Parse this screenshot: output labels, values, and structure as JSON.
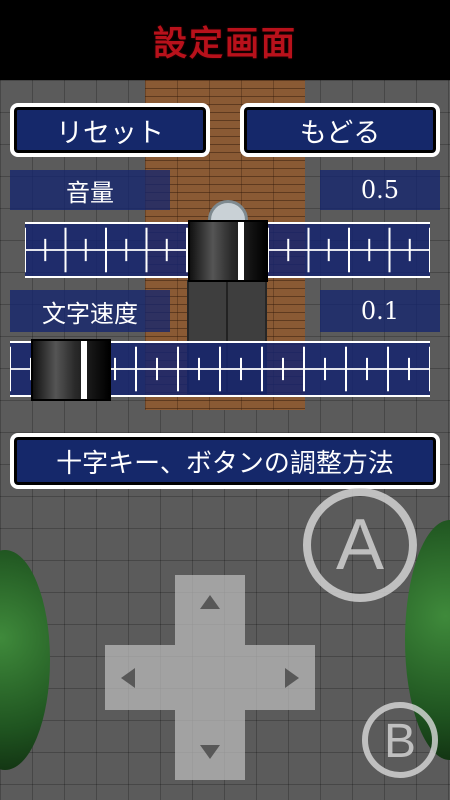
{
  "header": {
    "title": "設定画面"
  },
  "buttons": {
    "reset": "リセット",
    "back": "もどる",
    "adjust": "十字キー、ボタンの調整方法"
  },
  "volume": {
    "label": "音量",
    "value": "0.5",
    "level": 0.5
  },
  "text_speed": {
    "label": "文字速度",
    "value": "0.1",
    "level": 0.1
  },
  "controls": {
    "a_label": "A",
    "b_label": "B"
  },
  "colors": {
    "accent": "#b8111b",
    "panel": "#15286a"
  }
}
